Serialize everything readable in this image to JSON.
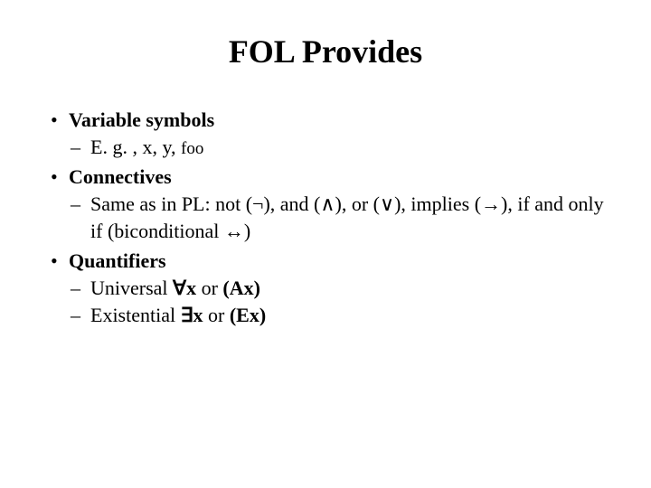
{
  "title": "FOL Provides",
  "bullets": {
    "b1": {
      "label": "Variable symbols",
      "sub1_prefix": "E. g. , x, y, ",
      "sub1_foo": "foo"
    },
    "b2": {
      "label": "Connectives",
      "sub1_a": "Same as in PL: not (",
      "sub1_not": "¬",
      "sub1_b": "), and (",
      "sub1_and": "∧",
      "sub1_c": "), or (",
      "sub1_or": "∨",
      "sub1_d": "), implies (",
      "sub1_imp": "→",
      "sub1_e": "), if and only if (biconditional ",
      "sub1_iff": "↔",
      "sub1_f": ")"
    },
    "b3": {
      "label": "Quantifiers",
      "sub1_a": "Universal ",
      "sub1_sym": "∀",
      "sub1_b": "x",
      "sub1_c": " or  ",
      "sub1_d": "(Ax)",
      "sub2_a": "Existential ",
      "sub2_sym": "∃",
      "sub2_b": "x",
      "sub2_c": " or ",
      "sub2_d": "(Ex)"
    }
  }
}
